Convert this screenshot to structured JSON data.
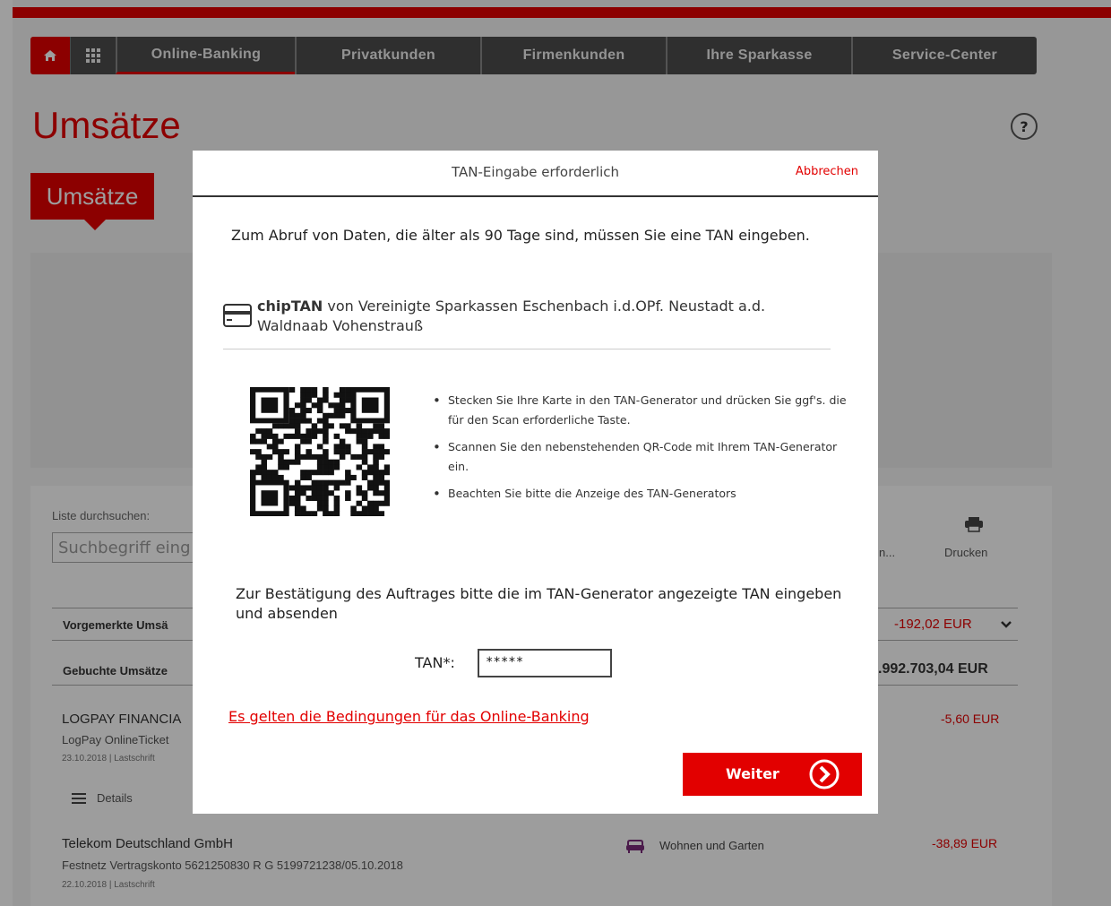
{
  "nav": {
    "items": [
      "Online-Banking",
      "Privatkunden",
      "Firmenkunden",
      "Ihre Sparkasse",
      "Service-Center"
    ]
  },
  "page": {
    "title": "Umsätze",
    "tab_active": "Umsätze",
    "help": "?"
  },
  "list": {
    "search_label": "Liste durchsuchen:",
    "search_placeholder": "Suchbegriff eing",
    "print_label": "Drucken",
    "truncated_action": "n...",
    "pending_label": "Vorgemerkte Umsä",
    "pending_amount": "-192,02 EUR",
    "booked_label": "Gebuchte Umsätze",
    "booked_amount": ".992.703,04 EUR",
    "tx1_name": "LOGPAY FINANCIA",
    "tx1_detail": "LogPay OnlineTicket",
    "tx1_date": "23.10.2018 | Lastschrift",
    "tx1_amount": "-5,60 EUR",
    "details_label": "Details",
    "tx2_name": "Telekom Deutschland GmbH",
    "tx2_detail": "Festnetz Vertragskonto 5621250830 R G 5199721238/05.10.2018",
    "tx2_date": "22.10.2018 | Lastschrift",
    "tx2_category": "Wohnen und Garten",
    "tx2_amount": "-38,89 EUR"
  },
  "modal": {
    "title": "TAN-Eingabe erforderlich",
    "cancel": "Abbrechen",
    "intro": "Zum Abruf von Daten, die älter als 90 Tage sind, müssen Sie eine TAN eingeben.",
    "chip_prefix": "chipTAN",
    "chip_text": " von Vereinigte Sparkassen Eschenbach i.d.OPf. Neustadt a.d. Waldnaab Vohenstrauß",
    "steps": [
      "Stecken Sie Ihre Karte in den TAN-Generator und drücken Sie ggf's. die für den Scan erforderliche Taste.",
      "Scannen Sie den nebenstehenden QR-Code mit Ihrem TAN-Generator ein.",
      "Beachten Sie bitte die Anzeige des TAN-Generators"
    ],
    "confirm_text": "Zur Bestätigung des Auftrages bitte die im TAN-Generator angezeigte TAN eingeben und absenden",
    "tan_label": "TAN*:",
    "tan_value": "*****",
    "terms_link": "Es gelten die Bedingungen für das Online-Banking",
    "submit": "Weiter"
  },
  "colors": {
    "brand_red": "#e20000",
    "nav_dark": "#4d4d4d"
  }
}
